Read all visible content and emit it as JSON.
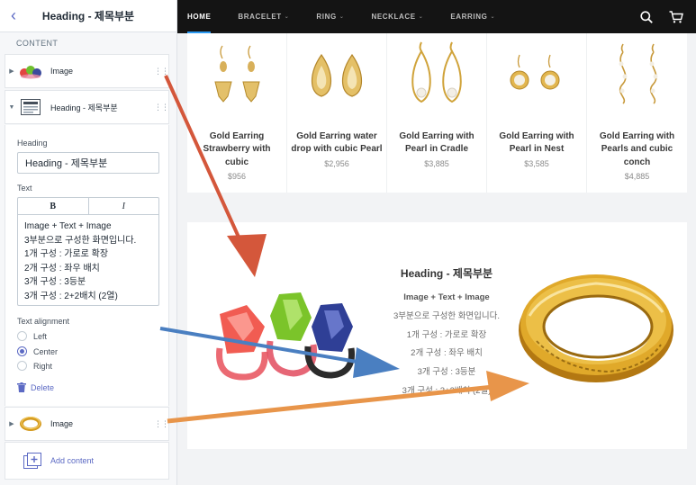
{
  "editor": {
    "title": "Heading - 제목부분",
    "section_label": "CONTENT",
    "blocks": [
      {
        "label": "Image"
      },
      {
        "label": "Heading - 제목부분"
      },
      {
        "label": "Image"
      }
    ],
    "heading_field": {
      "label": "Heading",
      "value": "Heading - 제목부분"
    },
    "text_field": {
      "label": "Text",
      "bold_label": "B",
      "italic_label": "I",
      "lines": [
        "Image + Text + Image",
        "3부분으로 구성한 화면입니다.",
        "1개  구성 : 가로로 확장",
        "2개 구성 : 좌우 배치",
        "3개 구성 : 3등분",
        "3개 구성 : 2+2배치 (2열)"
      ]
    },
    "alignment": {
      "label": "Text alignment",
      "options": [
        "Left",
        "Center",
        "Right"
      ],
      "selected": "Center"
    },
    "delete_label": "Delete",
    "add_content_label": "Add content"
  },
  "store": {
    "nav": [
      {
        "label": "HOME",
        "active": true,
        "dropdown": false
      },
      {
        "label": "BRACELET",
        "active": false,
        "dropdown": true
      },
      {
        "label": "RING",
        "active": false,
        "dropdown": true
      },
      {
        "label": "NECKLACE",
        "active": false,
        "dropdown": true
      },
      {
        "label": "EARRING",
        "active": false,
        "dropdown": true
      }
    ],
    "products": [
      {
        "title": "Gold Earring Strawberry with cubic",
        "price": "$956"
      },
      {
        "title": "Gold Earring water drop with cubic Pearl",
        "price": "$2,956"
      },
      {
        "title": "Gold Earring with Pearl in Cradle",
        "price": "$3,885"
      },
      {
        "title": "Gold Earring with Pearl in Nest",
        "price": "$3,585"
      },
      {
        "title": "Gold Earring with Pearls and cubic conch",
        "price": "$4,885"
      }
    ],
    "feature": {
      "heading": "Heading - 제목부분",
      "lines": [
        "Image + Text + Image",
        "3부분으로 구성한 화면입니다.",
        "1개  구성 : 가로로 확장",
        "2개 구성 : 좌우 배치",
        "3개 구성 : 3등분",
        "3개 구성 : 2+2배치 (2열)"
      ]
    }
  },
  "colors": {
    "accent": "#5c6ac4",
    "nav_bg": "#141414",
    "arrow_red": "#d4573b",
    "arrow_blue": "#4a7fc1",
    "arrow_orange": "#e8954a",
    "gold": "#d9a52b"
  },
  "icons": [
    "back-arrow-icon",
    "drag-handle-icon",
    "caret-right-icon",
    "caret-down-icon",
    "text-block-icon",
    "trash-icon",
    "add-content-icon",
    "search-icon",
    "cart-icon"
  ]
}
